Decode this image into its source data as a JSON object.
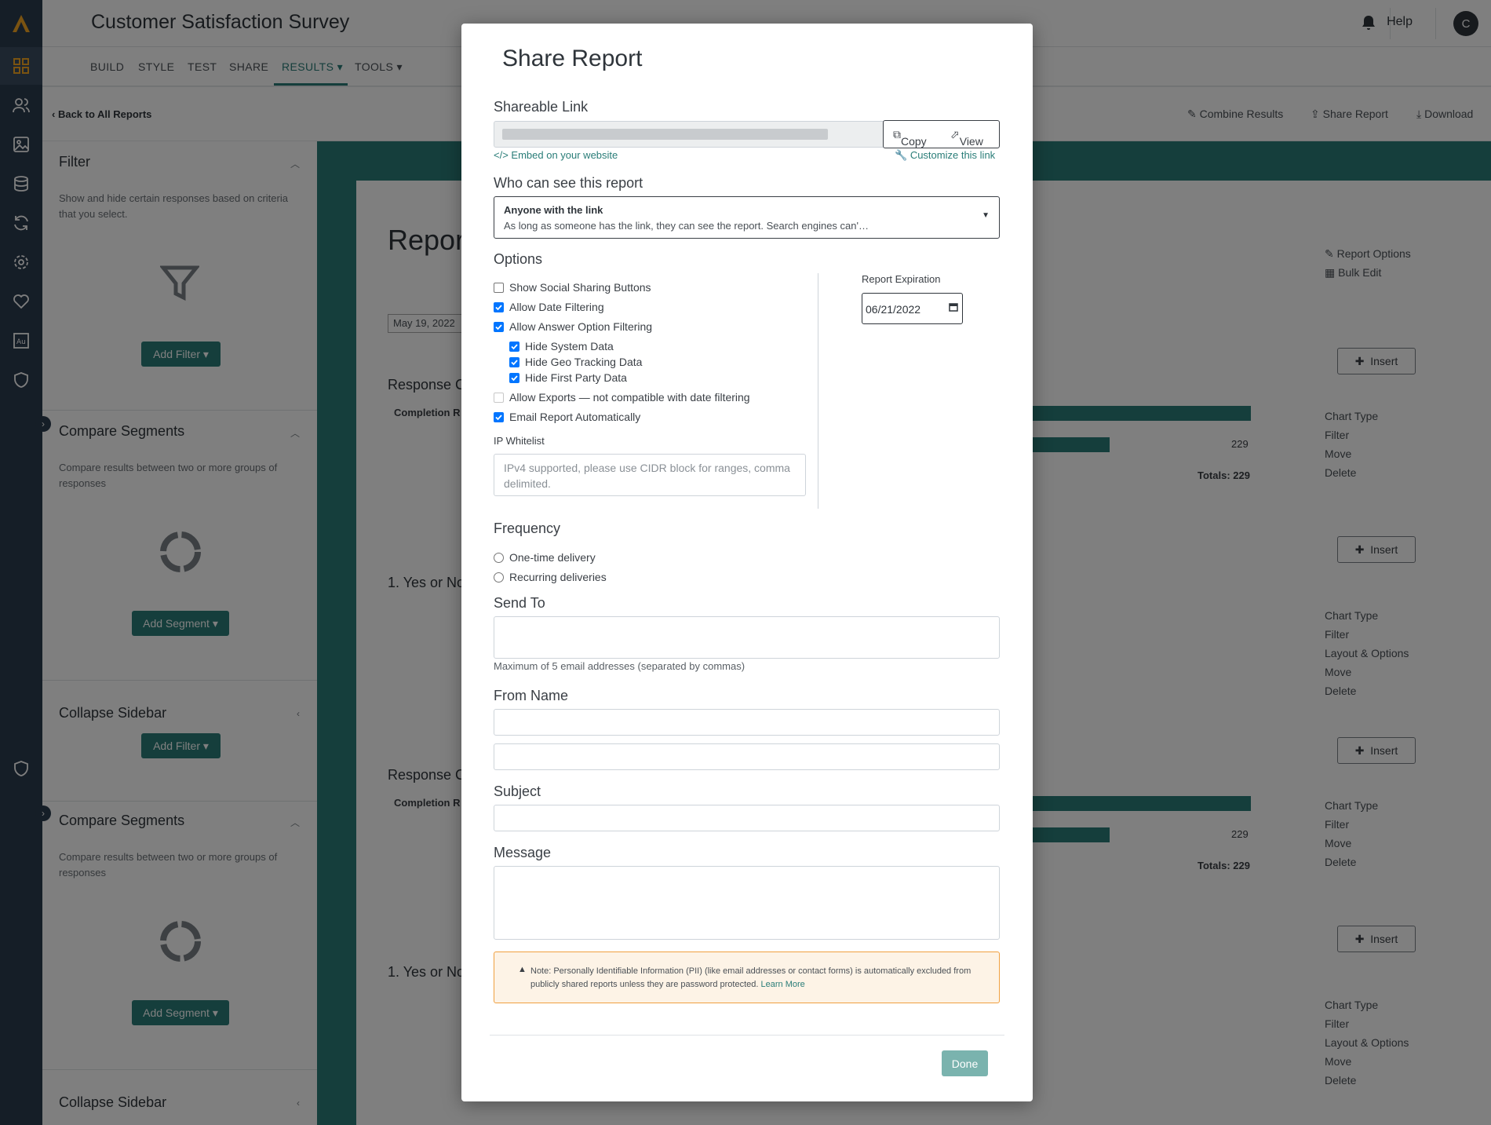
{
  "app": {
    "survey_title": "Customer Satisfaction Survey",
    "help_label": "Help",
    "avatar_initial": "C",
    "accent_color": "#2a7d78"
  },
  "nav": {
    "tabs": [
      "BUILD",
      "STYLE",
      "TEST",
      "SHARE",
      "RESULTS ▾",
      "TOOLS ▾"
    ]
  },
  "subbar": {
    "back_label": "Back to All Reports",
    "combine": "Combine Results",
    "share": "Share Report",
    "download": "Download"
  },
  "sidebar": {
    "filter_title": "Filter",
    "filter_desc": "Show and hide certain responses based on criteria that you select.",
    "add_filter": "Add Filter ▾",
    "compare_title": "Compare Segments",
    "compare_desc": "Compare results between two or more groups of responses",
    "add_segment": "Add Segment ▾",
    "collapse": "Collapse Sidebar"
  },
  "report": {
    "title_partial": "Repor",
    "date_partial": "May 19, 2022",
    "response_partial": "Response C",
    "completion_partial": "Completion R",
    "question_partial": "1. Yes or No",
    "count": "229",
    "totals": "Totals: 229",
    "report_options": "Report Options",
    "bulk_edit": "Bulk Edit",
    "insert": "Insert",
    "chart_type": "Chart Type",
    "filter": "Filter",
    "layout_options": "Layout & Options",
    "move": "Move",
    "delete": "Delete"
  },
  "modal": {
    "title": "Share Report",
    "shareable_link_label": "Shareable Link",
    "copy": "Copy",
    "view": "View",
    "embed": "</> Embed on your website",
    "customize": "Customize this link",
    "who_label": "Who can see this report",
    "who_selected": "Anyone with the link",
    "who_desc": "As long as someone has the link, they can see the report. Search engines can'…",
    "options_label": "Options",
    "options": [
      {
        "label": "Show Social Sharing Buttons",
        "checked": false
      },
      {
        "label": "Allow Date Filtering",
        "checked": true
      },
      {
        "label": "Allow Answer Option Filtering",
        "checked": true
      },
      {
        "label": "Hide System Data",
        "checked": true
      },
      {
        "label": "Hide Geo Tracking Data",
        "checked": true
      },
      {
        "label": "Hide First Party Data",
        "checked": true
      },
      {
        "label": "Allow Exports — not compatible with date filtering",
        "checked": false
      },
      {
        "label": "Email Report Automatically",
        "checked": true
      }
    ],
    "ip_whitelist_label": "IP Whitelist",
    "ip_placeholder": "IPv4 supported, please use CIDR block for ranges, comma delimited.",
    "expiration_label": "Report Expiration",
    "expiration_value": "06/21/2022",
    "frequency_label": "Frequency",
    "freq_once": "One-time delivery",
    "freq_recurring": "Recurring deliveries",
    "send_to_label": "Send To",
    "send_to_help": "Maximum of 5 email addresses (separated by commas)",
    "from_name_label": "From Name",
    "subject_label": "Subject",
    "message_label": "Message",
    "note": "Note: Personally Identifiable Information (PII) (like email addresses or contact forms) is automatically excluded from publicly shared reports unless they are password protected.",
    "learn_more": "Learn More",
    "done": "Done"
  }
}
